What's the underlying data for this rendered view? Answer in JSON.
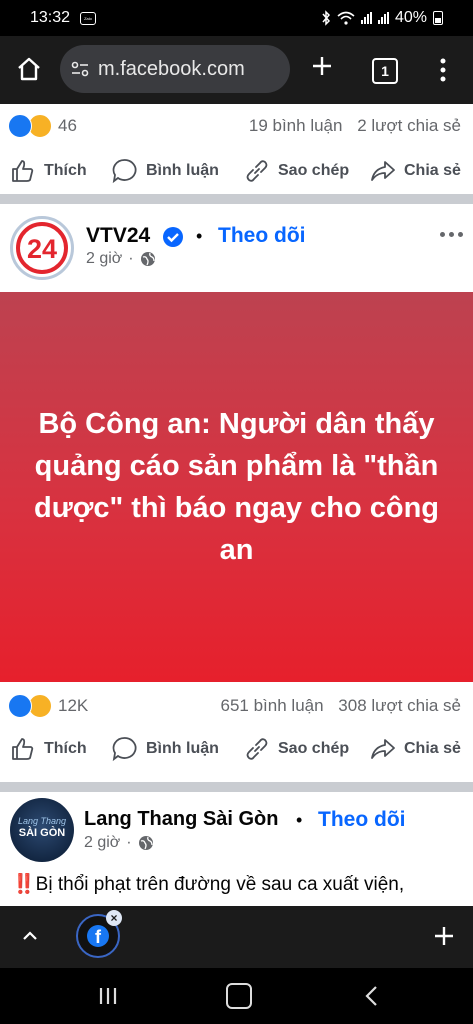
{
  "status": {
    "time": "13:32",
    "notif_app": "Zalo",
    "battery": "40%"
  },
  "browser": {
    "url": "m.facebook.com",
    "tab_count": "1"
  },
  "post1": {
    "reaction_count": "46",
    "comments": "19 bình luận",
    "shares": "2 lượt chia sẻ"
  },
  "actions": {
    "like": "Thích",
    "comment": "Bình luận",
    "copy": "Sao chép",
    "share": "Chia sẻ"
  },
  "post2": {
    "page_name": "VTV24",
    "follow": "Theo dõi",
    "time": "2 giờ",
    "logo_text": "24",
    "banner_text": "Bộ Công an: Người dân thấy quảng cáo sản phẩm là \"thần dược\" thì báo ngay cho công an",
    "reaction_count": "12K",
    "comments": "651 bình luận",
    "shares": "308 lượt chia sẻ"
  },
  "post3": {
    "page_name": "Lang Thang Sài Gòn",
    "follow": "Theo dõi",
    "time": "2 giờ",
    "logo_line1": "Lang Thang",
    "logo_line2": "SÀI GÒN",
    "text_prefix": "‼️",
    "text": "Bị thổi phạt trên đường về sau ca xuất viện,"
  },
  "colors": {
    "facebook_blue": "#0866ff",
    "banner_red": "#e6202c"
  }
}
